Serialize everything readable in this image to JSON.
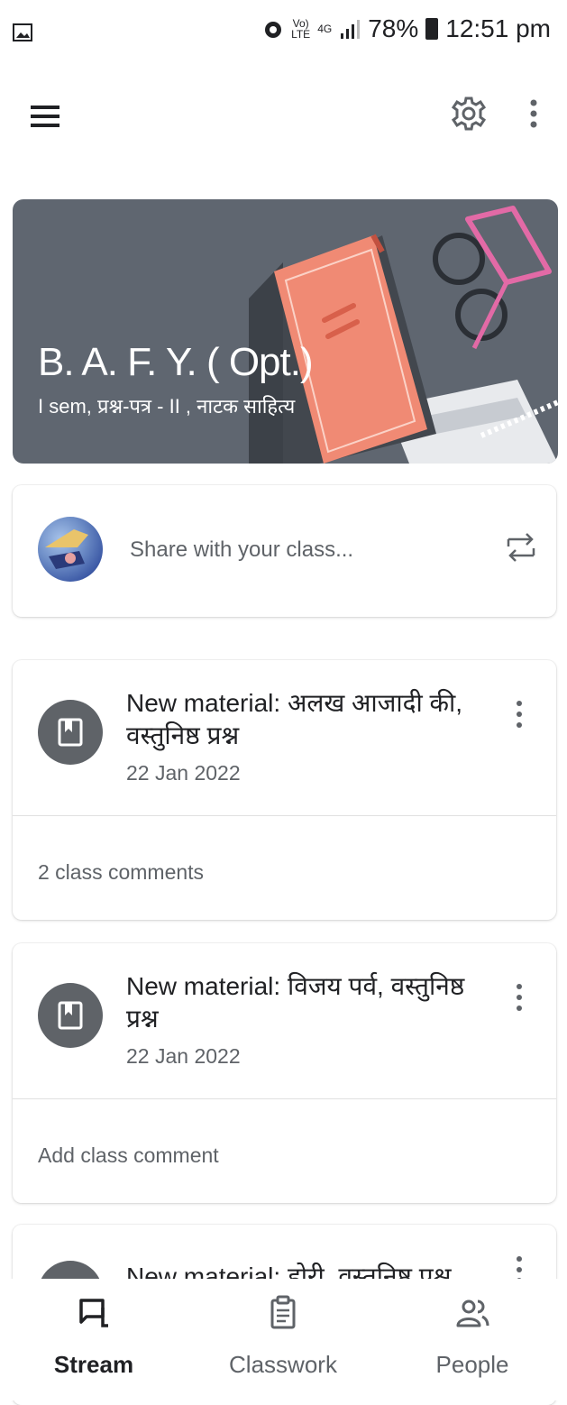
{
  "status_bar": {
    "volte": "Vo)",
    "lte": "LTE",
    "network": "4G",
    "battery": "78%",
    "time": "12:51 pm"
  },
  "app_bar": {
    "icons": [
      "menu-icon",
      "settings-icon",
      "more-vert-icon"
    ]
  },
  "banner": {
    "title": "B. A. F. Y. ( Opt.)",
    "subtitle": "I sem, प्रश्न-पत्र  - II , नाटक साहित्य"
  },
  "share": {
    "placeholder": "Share with your class..."
  },
  "posts": [
    {
      "title": "New material: अलख आजादी की, वस्तुनिष्ठ प्रश्न",
      "date": "22 Jan 2022",
      "footer": "2 class comments"
    },
    {
      "title": "New material: विजय पर्व, वस्तुनिष्ठ प्रश्न",
      "date": "22 Jan 2022",
      "footer": "Add class comment"
    },
    {
      "title": "New material: होरी, वस्तुनिष्ठ प्रश्न"
    }
  ],
  "bottom_nav": {
    "items": [
      {
        "label": "Stream",
        "icon": "stream-icon",
        "active": true
      },
      {
        "label": "Classwork",
        "icon": "classwork-icon",
        "active": false
      },
      {
        "label": "People",
        "icon": "people-icon",
        "active": false
      }
    ]
  },
  "colors": {
    "banner_bg": "#5f6670",
    "icon_circle": "#5f6368",
    "text_primary": "#202124",
    "text_secondary": "#5f6368"
  }
}
